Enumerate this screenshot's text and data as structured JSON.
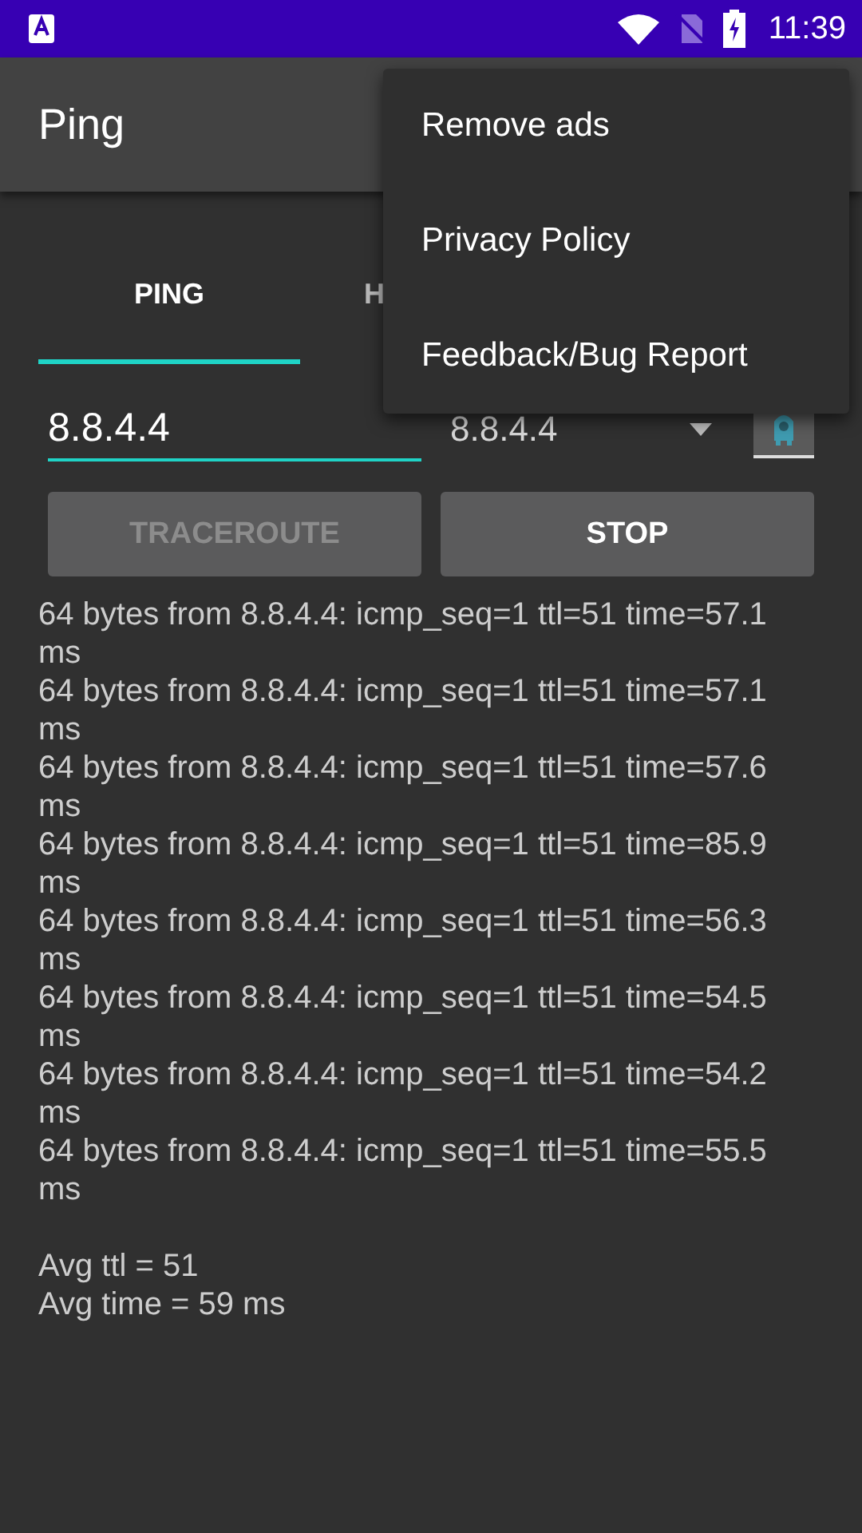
{
  "status_bar": {
    "time": "11:39"
  },
  "app_bar": {
    "title": "Ping"
  },
  "tabs": [
    {
      "label": "PING",
      "selected": true
    },
    {
      "label": "H",
      "selected": false
    }
  ],
  "host_field": {
    "value": "8.8.4.4"
  },
  "host_dropdown": {
    "value": "8.8.4.4"
  },
  "buttons": [
    {
      "label": "TRACEROUTE",
      "disabled": true
    },
    {
      "label": "STOP",
      "disabled": false
    }
  ],
  "output_lines": [
    "64 bytes from 8.8.4.4: icmp_seq=1 ttl=51 time=57.1 ms",
    "64 bytes from 8.8.4.4: icmp_seq=1 ttl=51 time=57.1 ms",
    "64 bytes from 8.8.4.4: icmp_seq=1 ttl=51 time=57.6 ms",
    "64 bytes from 8.8.4.4: icmp_seq=1 ttl=51 time=85.9 ms",
    "64 bytes from 8.8.4.4: icmp_seq=1 ttl=51 time=56.3 ms",
    "64 bytes from 8.8.4.4: icmp_seq=1 ttl=51 time=54.5 ms",
    "64 bytes from 8.8.4.4: icmp_seq=1 ttl=51 time=54.2 ms",
    "64 bytes from 8.8.4.4: icmp_seq=1 ttl=51 time=55.5 ms"
  ],
  "summary": [
    "Avg ttl = 51",
    "Avg time = 59 ms"
  ],
  "menu": {
    "items": [
      "Remove ads",
      "Privacy Policy",
      "Feedback/Bug Report"
    ]
  }
}
